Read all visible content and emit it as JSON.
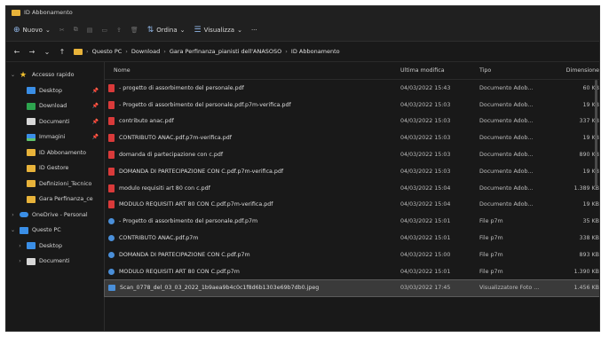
{
  "window": {
    "title": "ID Abbonamento"
  },
  "toolbar": {
    "new_label": "Nuovo",
    "sort_label": "Ordina",
    "view_label": "Visualizza",
    "more_label": "···"
  },
  "address": {
    "crumbs": [
      "Questo PC",
      "Download",
      "Gara Perfinanza_pianisti dell'ANASOSO",
      "ID Abbonamento"
    ]
  },
  "sidebar": {
    "items": [
      {
        "label": "Accesso rapido",
        "icon": "star-icon",
        "indent": 0,
        "chev": "v"
      },
      {
        "label": "Desktop",
        "icon": "desktop-icon",
        "indent": 1,
        "pin": true
      },
      {
        "label": "Download",
        "icon": "download-icon",
        "indent": 1,
        "pin": true
      },
      {
        "label": "Documenti",
        "icon": "documents-icon",
        "indent": 1,
        "pin": true
      },
      {
        "label": "Immagini",
        "icon": "pictures-icon",
        "indent": 1,
        "pin": true
      },
      {
        "label": "ID Abbonamento",
        "icon": "folder-icon",
        "indent": 1
      },
      {
        "label": "ID Gestore",
        "icon": "folder-icon",
        "indent": 1
      },
      {
        "label": "Definizioni_Tecnico",
        "icon": "folder-icon",
        "indent": 1
      },
      {
        "label": "Gara Perfinanza_ce",
        "icon": "folder-icon",
        "indent": 1
      },
      {
        "label": "OneDrive - Personal",
        "icon": "onedrive-icon",
        "indent": 0,
        "chev": ">"
      },
      {
        "label": "Questo PC",
        "icon": "pc-icon",
        "indent": 0,
        "chev": "v"
      },
      {
        "label": "Desktop",
        "icon": "desktop-icon",
        "indent": 1,
        "chev": ">"
      },
      {
        "label": "Documenti",
        "icon": "documents-icon",
        "indent": 1,
        "chev": ">"
      }
    ]
  },
  "columns": {
    "name": "Nome",
    "date": "Ultima modifica",
    "type": "Tipo",
    "size": "Dimensione"
  },
  "files": [
    {
      "name": "- progetto di assorbimento del personale.pdf",
      "date": "04/03/2022 15:43",
      "type": "Documento Adob...",
      "size": "60 KB",
      "kind": "pdf"
    },
    {
      "name": "- Progetto di assorbimento del personale.pdf.p7m-verifica.pdf",
      "date": "04/03/2022 15:03",
      "type": "Documento Adob...",
      "size": "19 KB",
      "kind": "pdf"
    },
    {
      "name": "contributo anac.pdf",
      "date": "04/03/2022 15:03",
      "type": "Documento Adob...",
      "size": "337 KB",
      "kind": "pdf"
    },
    {
      "name": "CONTRIBUTO ANAC.pdf.p7m-verifica.pdf",
      "date": "04/03/2022 15:03",
      "type": "Documento Adob...",
      "size": "19 KB",
      "kind": "pdf"
    },
    {
      "name": "domanda di partecipazione con c.pdf",
      "date": "04/03/2022 15:03",
      "type": "Documento Adob...",
      "size": "890 KB",
      "kind": "pdf"
    },
    {
      "name": "DOMANDA DI PARTECIPAZIONE CON C.pdf.p7m-verifica.pdf",
      "date": "04/03/2022 15:03",
      "type": "Documento Adob...",
      "size": "19 KB",
      "kind": "pdf"
    },
    {
      "name": "modulo requisiti art 80 con c.pdf",
      "date": "04/03/2022 15:04",
      "type": "Documento Adob...",
      "size": "1.389 KB",
      "kind": "pdf"
    },
    {
      "name": "MODULO REQUISITI ART 80 CON C.pdf.p7m-verifica.pdf",
      "date": "04/03/2022 15:04",
      "type": "Documento Adob...",
      "size": "19 KB",
      "kind": "pdf"
    },
    {
      "name": "- Progetto di assorbimento del personale.pdf.p7m",
      "date": "04/03/2022 15:01",
      "type": "File p7m",
      "size": "35 KB",
      "kind": "p7m"
    },
    {
      "name": "CONTRIBUTO ANAC.pdf.p7m",
      "date": "04/03/2022 15:01",
      "type": "File p7m",
      "size": "338 KB",
      "kind": "p7m"
    },
    {
      "name": "DOMANDA DI PARTECIPAZIONE CON C.pdf.p7m",
      "date": "04/03/2022 15:00",
      "type": "File p7m",
      "size": "893 KB",
      "kind": "p7m"
    },
    {
      "name": "MODULO REQUISITI ART 80 CON C.pdf.p7m",
      "date": "04/03/2022 15:01",
      "type": "File p7m",
      "size": "1.390 KB",
      "kind": "p7m"
    },
    {
      "name": "Scan_0778_del_03_03_2022_1b9aea9b4c0c1f8d6b1303e69b7db0.jpeg",
      "date": "03/03/2022 17:45",
      "type": "Visualizzatore Foto ...",
      "size": "1.456 KB",
      "kind": "img",
      "selected": true
    }
  ]
}
